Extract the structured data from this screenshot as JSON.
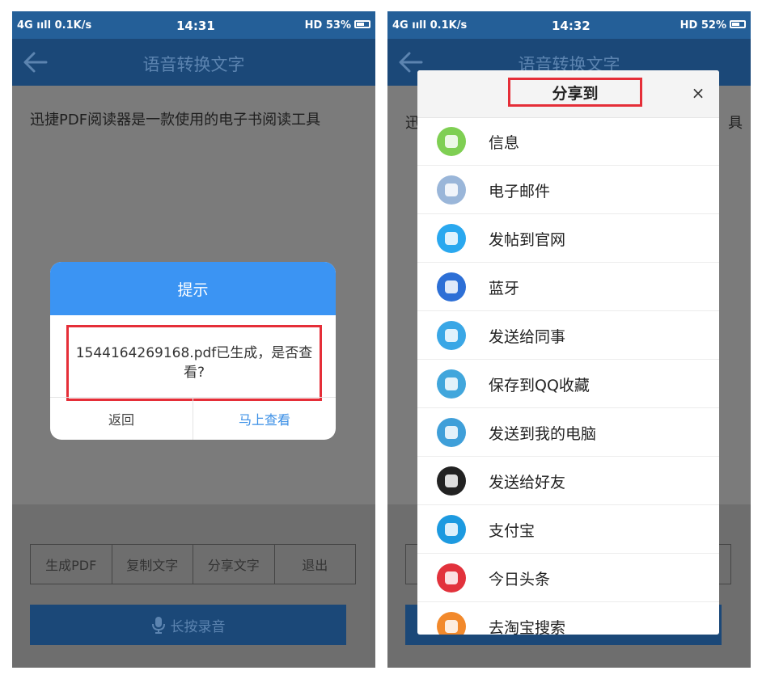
{
  "status_left": {
    "network": "4G ııll 0.1K/s",
    "time": "14:31",
    "right": "HD 53%"
  },
  "status_right": {
    "network": "4G ııll 0.1K/s",
    "time": "14:32",
    "right": "HD 52%"
  },
  "app": {
    "title": "语音转换文字",
    "content": "迅捷PDF阅读器是一款使用的电子书阅读工具",
    "content_left_fragment": "迅",
    "content_right_fragment": "具"
  },
  "buttons": {
    "generate_pdf": "生成PDF",
    "copy_text": "复制文字",
    "share_text": "分享文字",
    "exit": "退出",
    "hold_record": "长按录音"
  },
  "dialog": {
    "title": "提示",
    "message": "1544164269168.pdf已生成，是否查看?",
    "back": "返回",
    "view_now": "马上查看"
  },
  "share": {
    "title": "分享到",
    "close": "×",
    "items": [
      {
        "label": "信息",
        "color": "#7fcf53"
      },
      {
        "label": "电子邮件",
        "color": "#9ab6d9"
      },
      {
        "label": "发帖到官网",
        "color": "#2aa8ef"
      },
      {
        "label": "蓝牙",
        "color": "#2d6fd6"
      },
      {
        "label": "发送给同事",
        "color": "#3aa7e6"
      },
      {
        "label": "保存到QQ收藏",
        "color": "#41a6dc"
      },
      {
        "label": "发送到我的电脑",
        "color": "#3f9fd9"
      },
      {
        "label": "发送给好友",
        "color": "#222222"
      },
      {
        "label": "支付宝",
        "color": "#1d9ae0"
      },
      {
        "label": "今日头条",
        "color": "#e2323c"
      },
      {
        "label": "去淘宝搜索",
        "color": "#f2892b"
      }
    ]
  }
}
